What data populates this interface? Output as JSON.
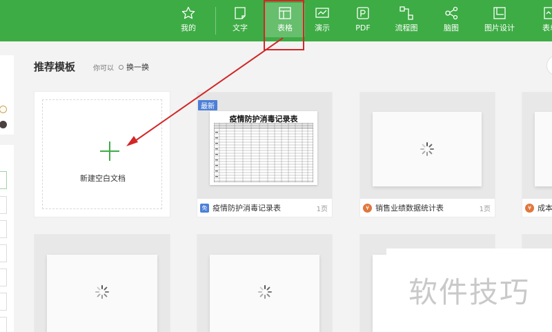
{
  "toolbar": {
    "items": [
      {
        "label": "我的",
        "icon": "star-icon"
      },
      {
        "label": "文字",
        "icon": "document-icon"
      },
      {
        "label": "表格",
        "icon": "table-icon"
      },
      {
        "label": "演示",
        "icon": "presentation-icon"
      },
      {
        "label": "PDF",
        "icon": "pdf-icon"
      },
      {
        "label": "流程图",
        "icon": "flowchart-icon"
      },
      {
        "label": "脑图",
        "icon": "mindmap-icon"
      },
      {
        "label": "图片设计",
        "icon": "image-design-icon"
      },
      {
        "label": "表单",
        "icon": "form-icon"
      }
    ],
    "active": "表格",
    "accent": "#3dac44"
  },
  "main": {
    "heading": "推荐模板",
    "hint": "你可以",
    "refresh_label": "换一换"
  },
  "blank_card": {
    "label": "新建空白文档"
  },
  "templates": [
    {
      "title": "疫情防护消毒记录表",
      "pages": "1页",
      "badge": "最新",
      "sheet_title": "疫情防护消毒记录表",
      "icon_text": "免"
    },
    {
      "title": "销售业绩数据统计表",
      "pages": "1页",
      "icon_text": "¥"
    },
    {
      "title": "成本核",
      "icon_text": "¥"
    }
  ],
  "watermark": "软件技巧",
  "annotation_color": "#d32626"
}
